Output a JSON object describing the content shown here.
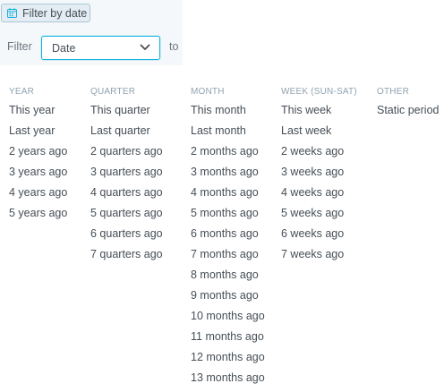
{
  "filter_button": {
    "label": "Filter by date"
  },
  "filter_row": {
    "label": "Filter",
    "select_value": "Date",
    "to_label": "to"
  },
  "columns": [
    {
      "header": "YEAR",
      "options": [
        "This year",
        "Last year",
        "2 years ago",
        "3 years ago",
        "4 years ago",
        "5 years ago"
      ]
    },
    {
      "header": "QUARTER",
      "options": [
        "This quarter",
        "Last quarter",
        "2 quarters ago",
        "3 quarters ago",
        "4 quarters ago",
        "5 quarters ago",
        "6 quarters ago",
        "7 quarters ago"
      ]
    },
    {
      "header": "MONTH",
      "options": [
        "This month",
        "Last month",
        "2 months ago",
        "3 months ago",
        "4 months ago",
        "5 months ago",
        "6 months ago",
        "7 months ago",
        "8 months ago",
        "9 months ago",
        "10 months ago",
        "11 months ago",
        "12 months ago",
        "13 months ago"
      ]
    },
    {
      "header": "WEEK (SUN-SAT)",
      "options": [
        "This week",
        "Last week",
        "2 weeks ago",
        "3 weeks ago",
        "4 weeks ago",
        "5 weeks ago",
        "6 weeks ago",
        "7 weeks ago"
      ]
    },
    {
      "header": "OTHER",
      "options": [
        "Static period"
      ]
    }
  ],
  "colors": {
    "accent": "#14b2e2",
    "header": "#8fa3b1",
    "text": "#464e56"
  },
  "icons": {
    "filter_button": "calendar-icon",
    "select": "chevron-down-icon"
  }
}
